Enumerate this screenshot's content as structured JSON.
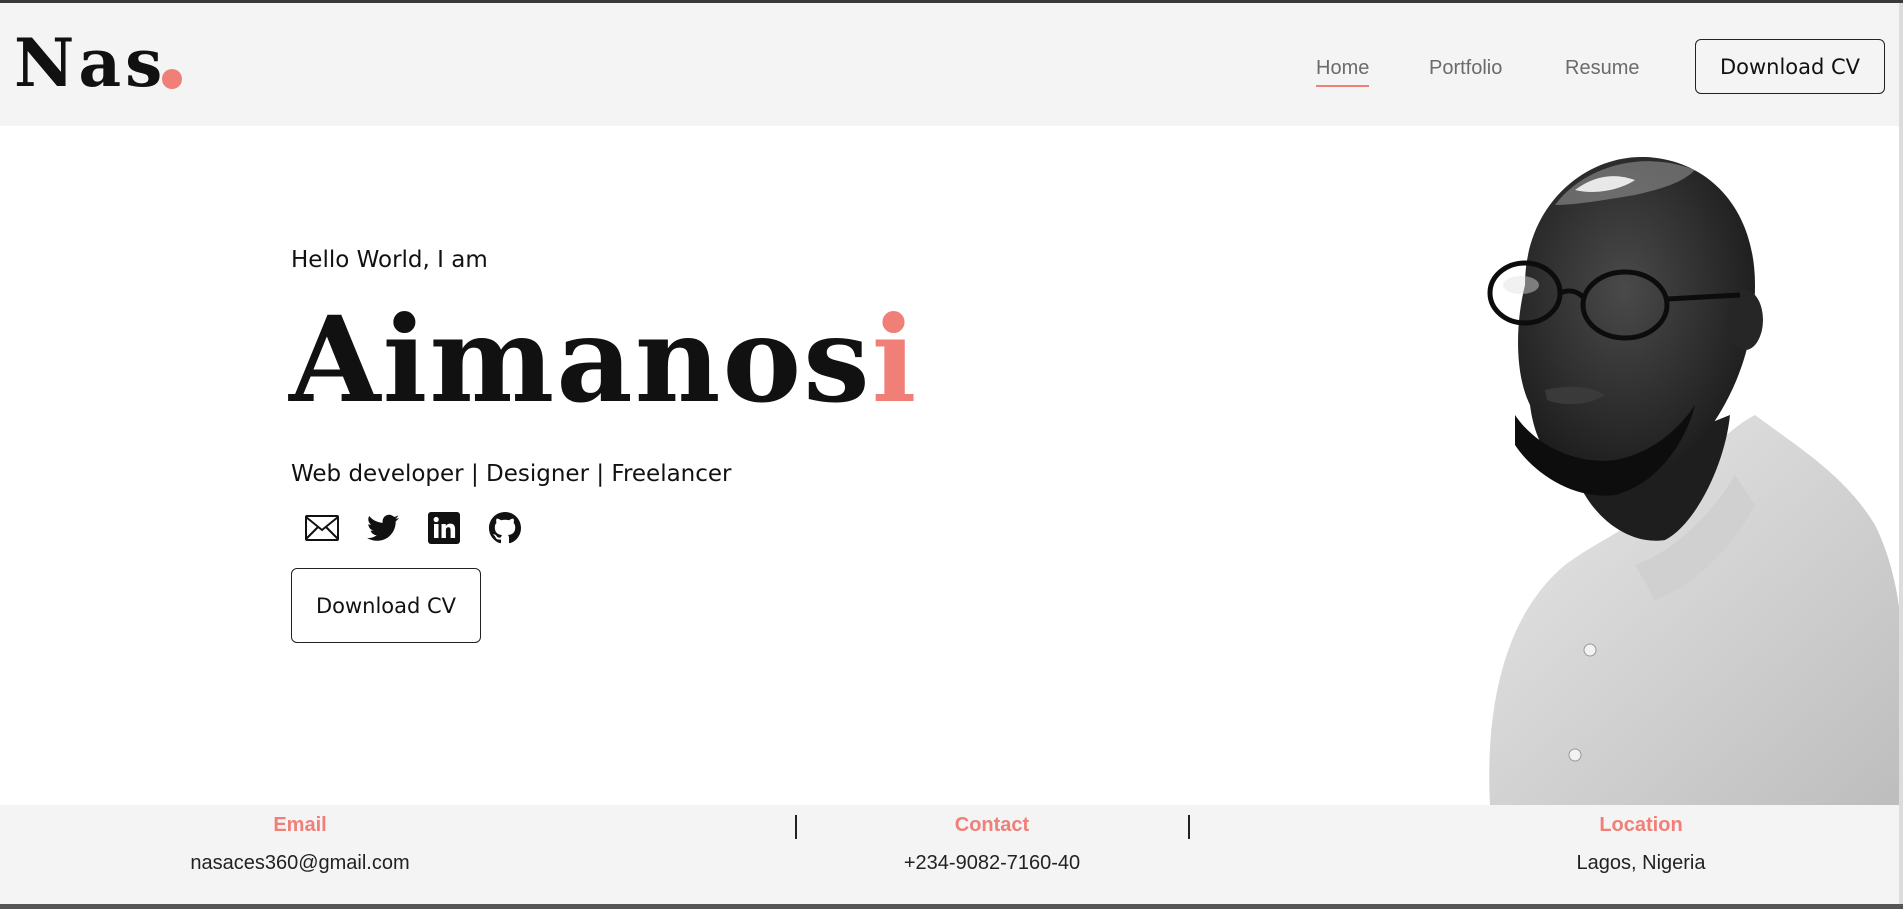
{
  "colors": {
    "accent": "#f07f77",
    "text": "#111111",
    "header_bg": "#f4f4f4"
  },
  "logo": {
    "text": "Nas"
  },
  "nav": {
    "items": [
      {
        "label": "Home",
        "active": true
      },
      {
        "label": "Portfolio",
        "active": false
      },
      {
        "label": "Resume",
        "active": false
      }
    ],
    "cta_label": "Download CV"
  },
  "hero": {
    "greeting": "Hello World, I am",
    "name_main": "Aimanos",
    "name_accent": "i",
    "roles": "Web developer | Designer | Freelancer",
    "social_icons": [
      "mail-icon",
      "twitter-icon",
      "linkedin-icon",
      "github-icon"
    ],
    "cta_label": "Download CV"
  },
  "info": {
    "email": {
      "title": "Email",
      "value": "nasaces360@gmail.com"
    },
    "contact": {
      "title": "Contact",
      "value": "+234-9082-7160-40"
    },
    "location": {
      "title": "Location",
      "value": "Lagos, Nigeria"
    }
  }
}
